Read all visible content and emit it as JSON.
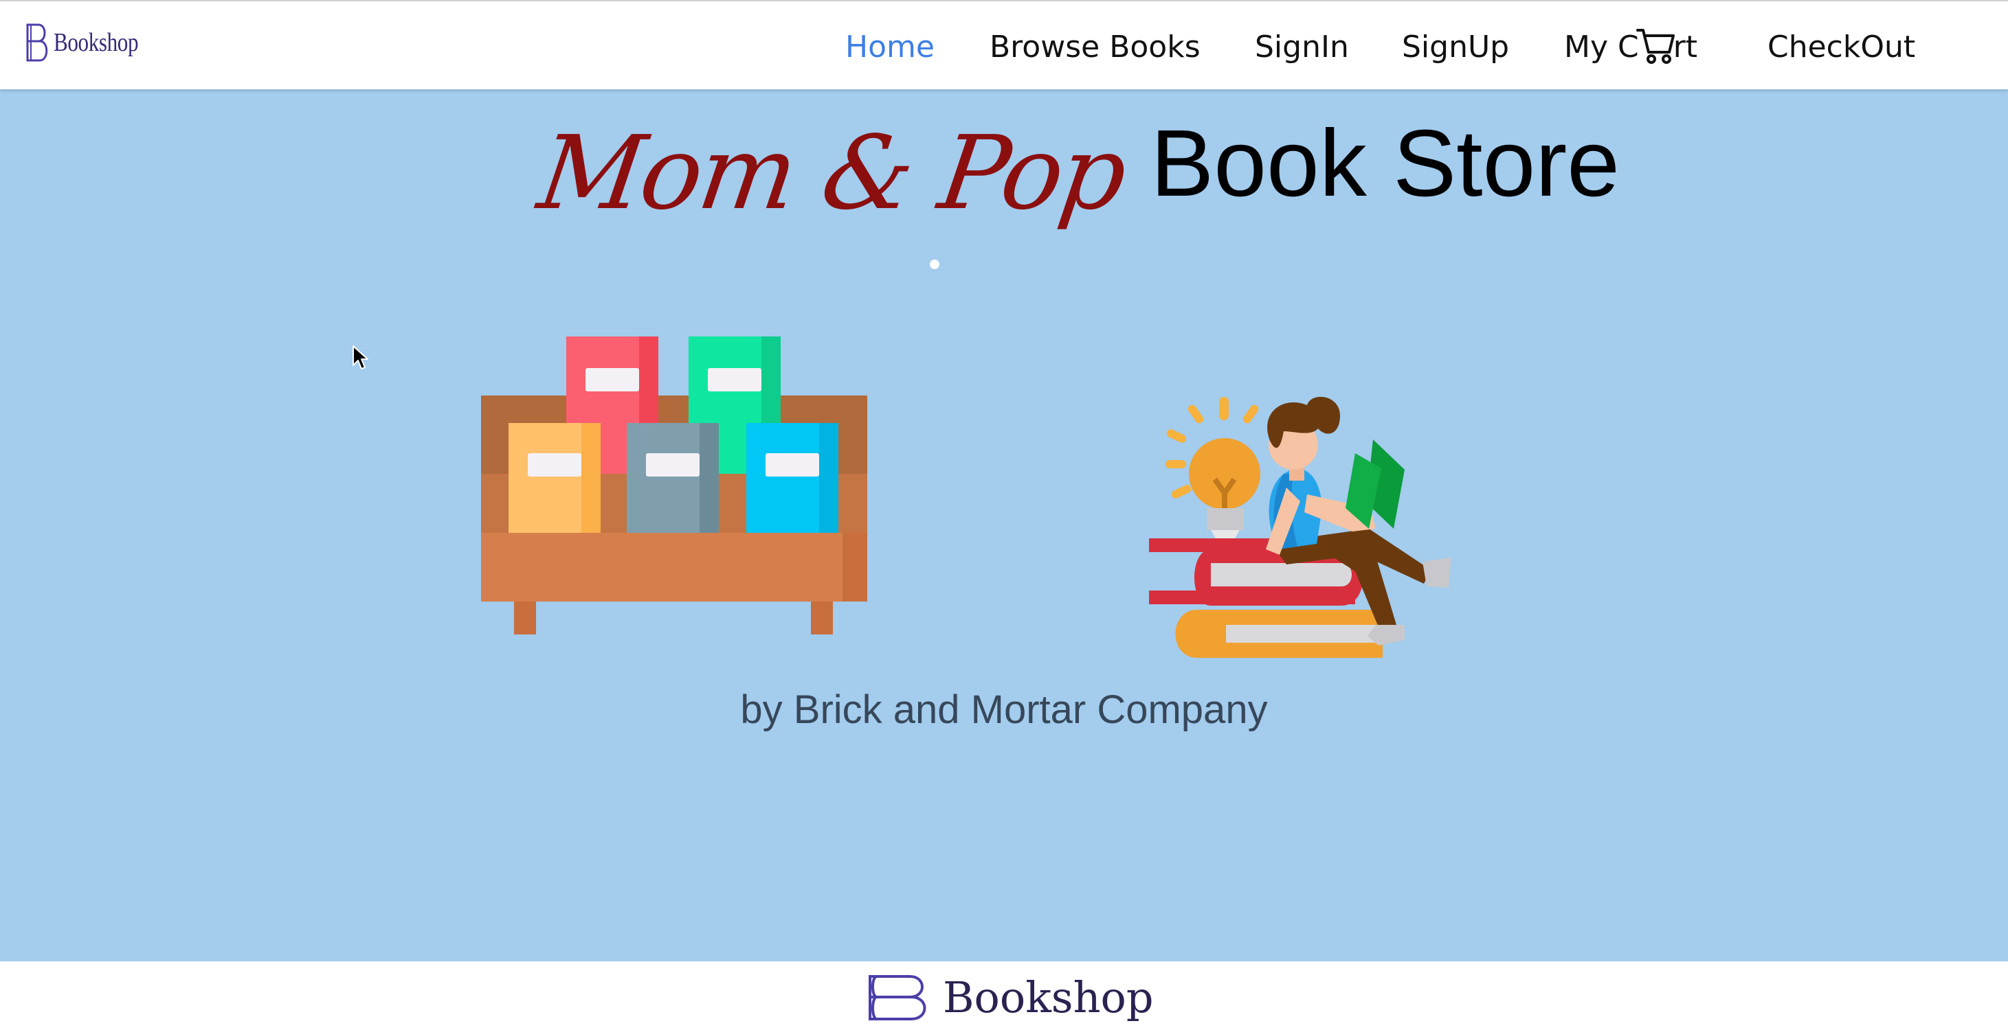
{
  "brand": {
    "name": "Bookshop"
  },
  "nav": {
    "items": [
      {
        "label": "Home",
        "active": true
      },
      {
        "label": "Browse Books",
        "active": false
      },
      {
        "label": "SignIn",
        "active": false
      },
      {
        "label": "SignUp",
        "active": false
      },
      {
        "label_prefix": "My C",
        "label_suffix": "rt",
        "icon": "cart-icon",
        "active": false
      },
      {
        "label": "CheckOut",
        "active": false
      }
    ]
  },
  "hero": {
    "title_script": "Mom & Pop",
    "title_plain": "Book Store",
    "subtitle": "by Brick and Mortar Company",
    "illustrations": [
      "bookshelf-illustration",
      "reading-person-illustration"
    ]
  },
  "footer": {
    "brand_name": "Bookshop"
  },
  "colors": {
    "hero_background": "#a3cced",
    "nav_active": "#3d7fe6",
    "title_script": "#8b0f0f",
    "brand": "#352a77"
  }
}
